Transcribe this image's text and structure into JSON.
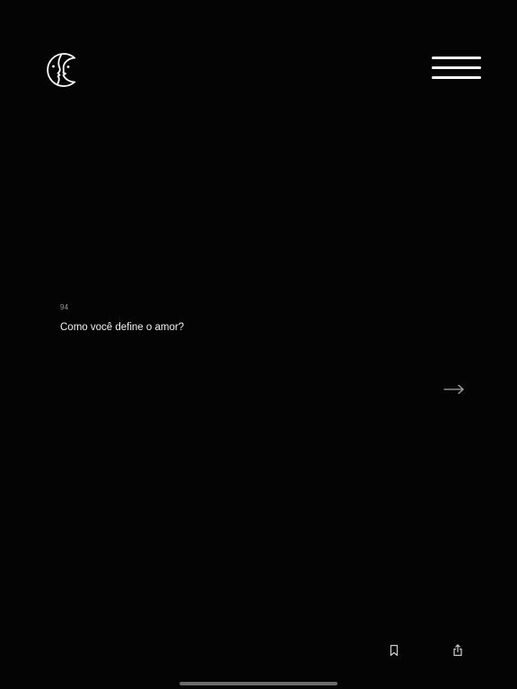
{
  "header": {
    "logo_icon": "two-faces-moon-logo-icon",
    "menu_icon": "hamburger-menu-icon"
  },
  "card": {
    "number": "94",
    "question": "Como você define o amor?",
    "next_icon": "arrow-right-icon"
  },
  "footer": {
    "bookmark_icon": "bookmark-icon",
    "share_icon": "share-icon"
  },
  "colors": {
    "background": "#040404",
    "foreground": "#ffffff",
    "muted": "#9a9a9a"
  }
}
